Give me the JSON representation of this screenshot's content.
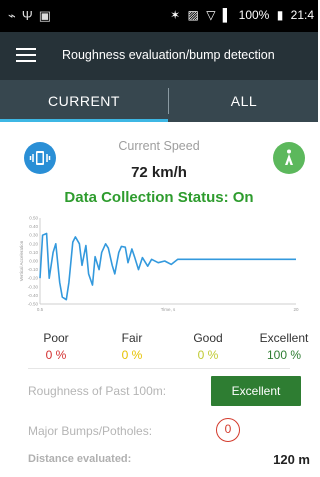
{
  "status_bar": {
    "left_icons": [
      "usb-icon",
      "antenna-icon",
      "android-icon"
    ],
    "battery_text": "100%",
    "time": "21:4"
  },
  "app_bar": {
    "title": "Roughness evaluation/bump detection",
    "menu_icon": "hamburger-menu-icon"
  },
  "tabs": [
    {
      "label": "CURRENT",
      "selected": true
    },
    {
      "label": "ALL",
      "selected": false
    }
  ],
  "speed": {
    "label": "Current Speed",
    "value": "72 km/h"
  },
  "collection_status": "Data Collection Status: On",
  "chart_data": {
    "type": "line",
    "title": "",
    "xlabel": "Time, s",
    "ylabel": "Vertical Acceleration",
    "x_tick_labels": [
      "0.5",
      "20"
    ],
    "y_tick_labels": [
      "0.50",
      "0.40",
      "0.30",
      "0.20",
      "0.10",
      "0.00",
      "-0.10",
      "-0.20",
      "-0.30",
      "-0.40",
      "-0.50"
    ],
    "xlim": [
      0.5,
      20
    ],
    "ylim": [
      -0.5,
      0.5
    ],
    "grid": false,
    "series": [
      {
        "color": "#3399dd",
        "x": [
          0.5,
          0.7,
          1.0,
          1.2,
          1.5,
          1.7,
          2.0,
          2.2,
          2.5,
          2.7,
          3.0,
          3.2,
          3.5,
          3.7,
          4.0,
          4.2,
          4.5,
          4.7,
          5.0,
          5.2,
          5.5,
          5.7,
          6.0,
          6.2,
          6.5,
          6.7,
          7.0,
          7.2,
          7.5,
          7.7,
          8.0,
          8.3,
          8.7,
          9.0,
          9.5,
          10.0,
          10.5,
          11.0,
          12.0,
          13.0,
          14.0,
          15.0,
          16.0,
          17.0,
          18.0,
          19.0,
          20.0
        ],
        "y": [
          -0.2,
          0.3,
          0.32,
          -0.2,
          0.1,
          0.2,
          -0.25,
          -0.42,
          -0.45,
          -0.25,
          0.22,
          0.28,
          0.2,
          -0.05,
          0.18,
          -0.15,
          -0.28,
          0.05,
          -0.1,
          0.1,
          0.2,
          0.15,
          -0.05,
          -0.15,
          0.1,
          0.17,
          0.16,
          -0.02,
          0.14,
          0.05,
          -0.1,
          0.04,
          -0.06,
          0.02,
          -0.02,
          0.0,
          -0.04,
          0.02,
          0.02,
          0.02,
          0.02,
          0.02,
          0.02,
          0.02,
          0.02,
          0.02,
          0.02
        ]
      }
    ]
  },
  "grades": [
    {
      "label": "Poor",
      "value": "0 %",
      "color": "#d32f2f"
    },
    {
      "label": "Fair",
      "value": "0 %",
      "color": "#e6c200"
    },
    {
      "label": "Good",
      "value": "0 %",
      "color": "#c0ca33"
    },
    {
      "label": "Excellent",
      "value": "100 %",
      "color": "#2e7d32"
    }
  ],
  "roughness": {
    "label": "Roughness of Past 100m:",
    "rating": "Excellent"
  },
  "bumps": {
    "label": "Major Bumps/Potholes:",
    "count": "0"
  },
  "distance": {
    "label": "Distance evaluated:",
    "value": "120 m"
  }
}
